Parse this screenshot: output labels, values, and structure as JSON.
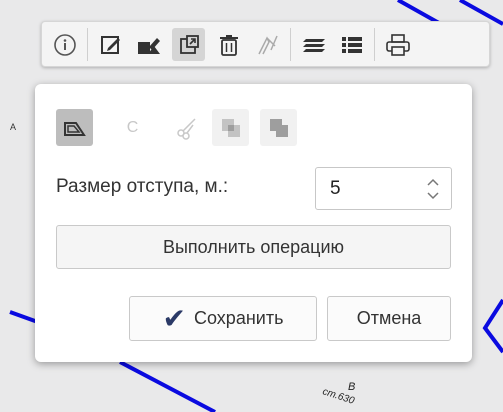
{
  "map": {
    "marker_letter": "A",
    "point_letter": "В",
    "point_code": "ст.630"
  },
  "toolbar": {
    "buttons": [
      {
        "icon": "info-icon"
      },
      {
        "icon": "edit-icon"
      },
      {
        "icon": "edit-object-icon"
      },
      {
        "icon": "external-window-icon"
      },
      {
        "icon": "trash-icon"
      },
      {
        "icon": "measure-icon"
      },
      {
        "icon": "layers-icon"
      },
      {
        "icon": "list-icon"
      },
      {
        "icon": "print-icon"
      }
    ]
  },
  "panel": {
    "operations": [
      {
        "icon": "buffer-icon",
        "state": "selected"
      },
      {
        "icon": "letter-c-icon",
        "glyph": "C",
        "state": "disabled"
      },
      {
        "icon": "scissors-icon",
        "state": "disabled"
      },
      {
        "icon": "intersect-icon",
        "state": "disabled"
      },
      {
        "icon": "union-icon",
        "state": "disabled"
      }
    ],
    "offset_label": "Размер отступа, м.:",
    "offset_value": "5",
    "execute_label": "Выполнить операцию",
    "save_label": "Сохранить",
    "cancel_label": "Отмена"
  },
  "colors": {
    "map_line": "#0a0ae0",
    "check": "#2b3a67",
    "selected_op": "#bdbdbd"
  }
}
